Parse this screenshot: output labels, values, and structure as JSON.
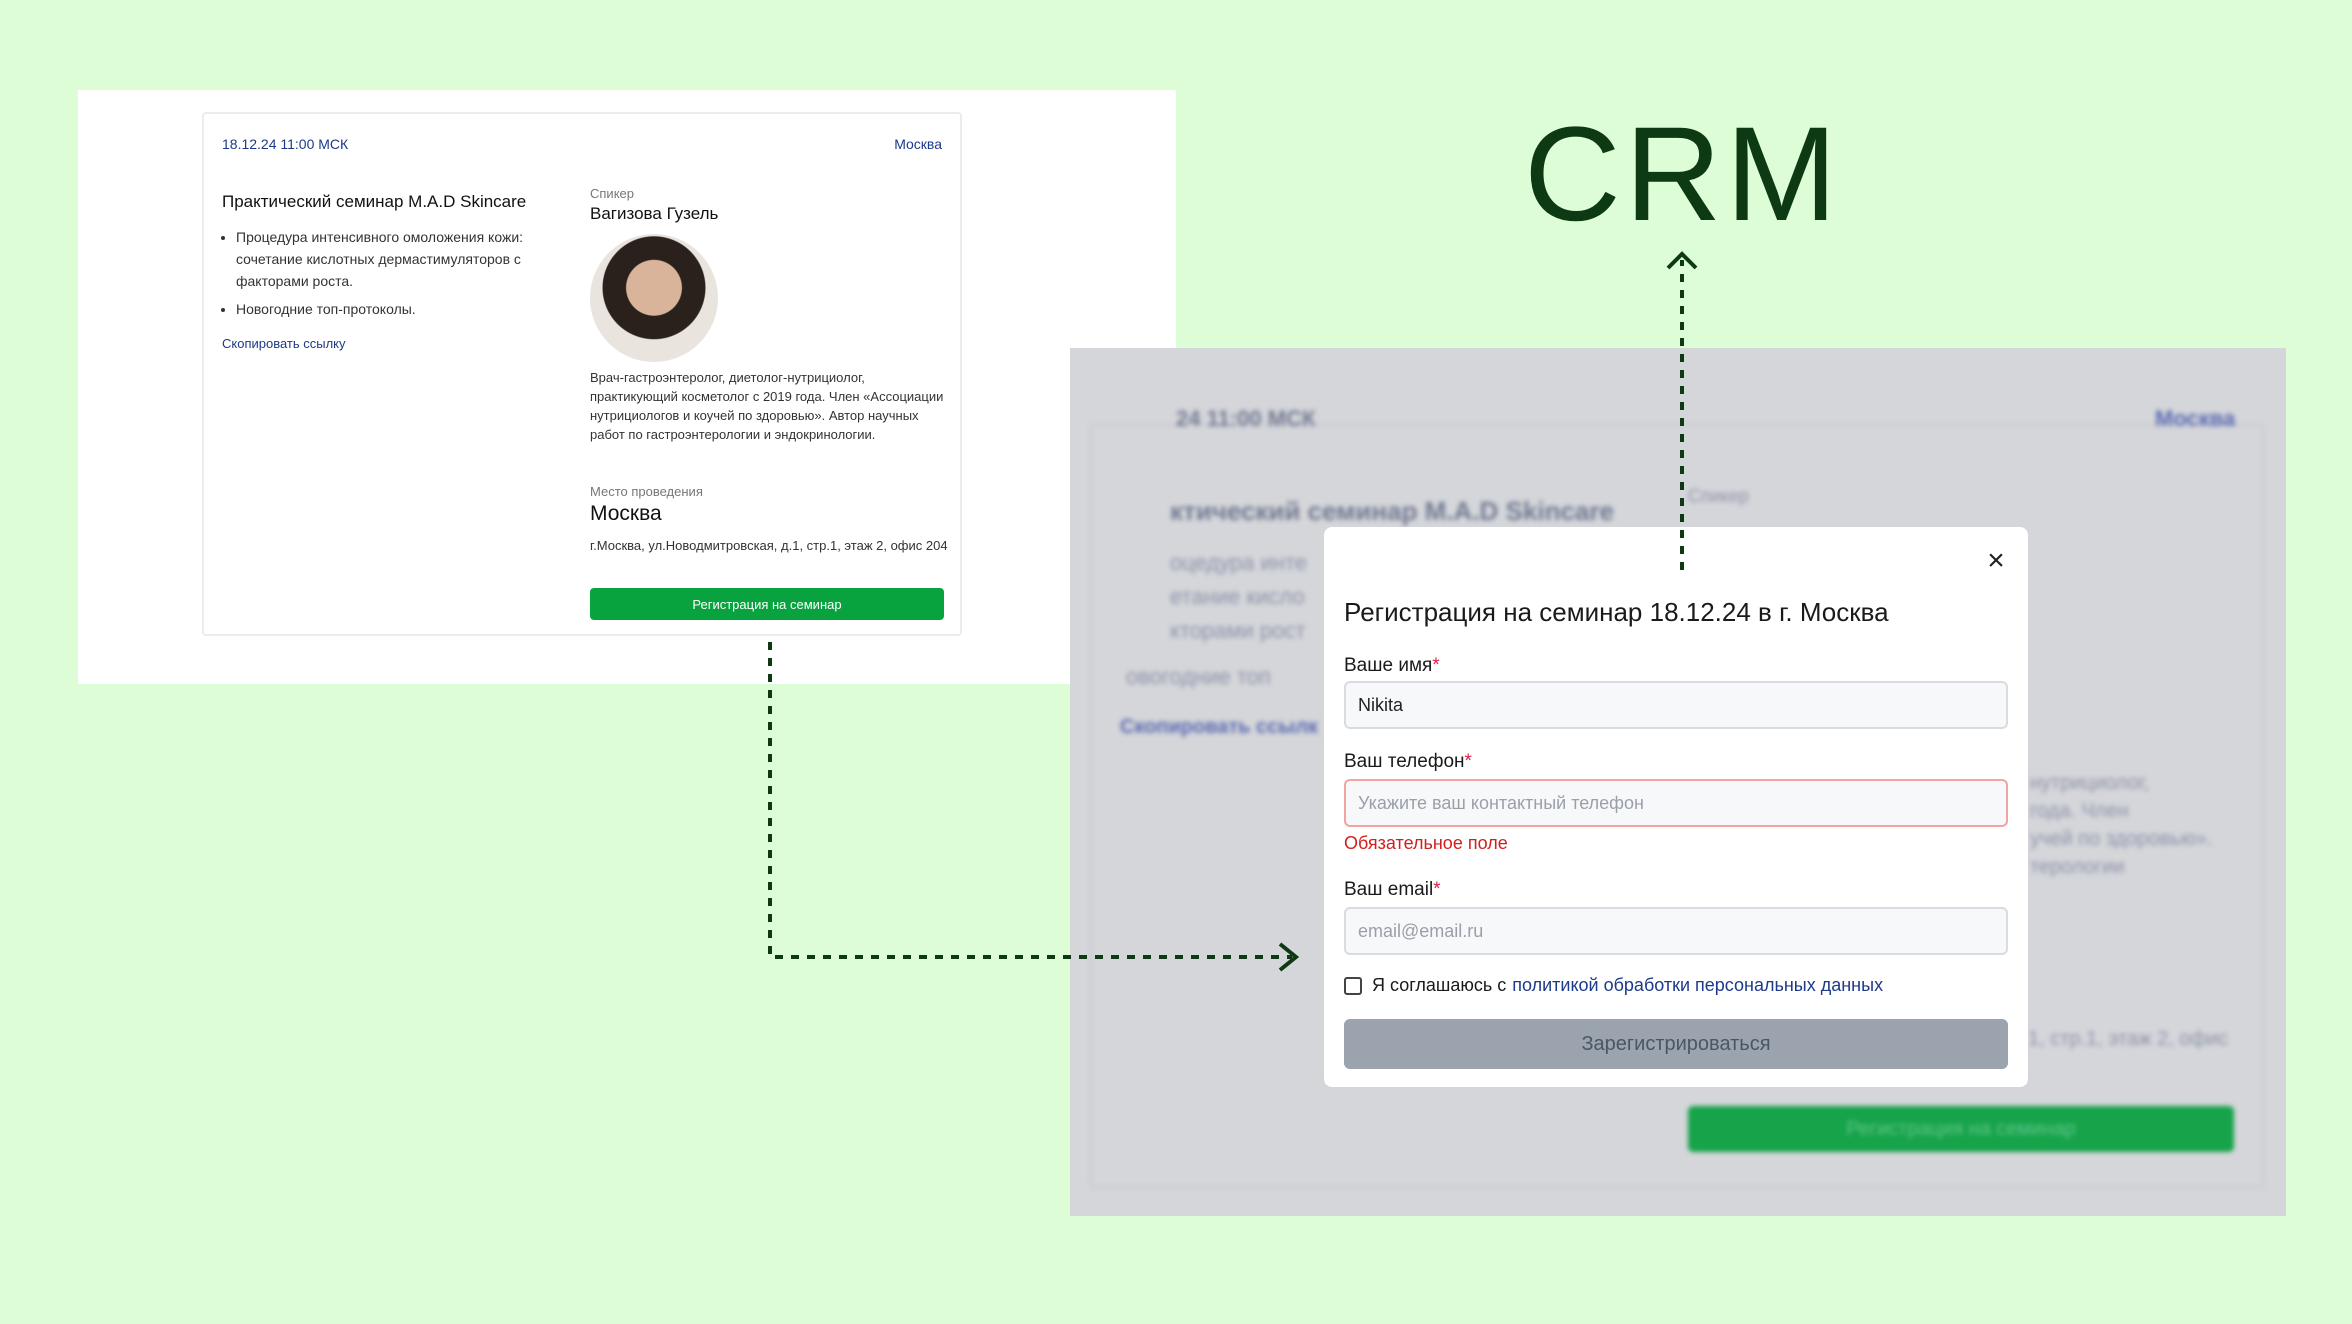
{
  "left_card": {
    "date": "18.12.24  11:00 МСК",
    "city_link": "Москва",
    "title": "Практический семинар M.A.D Skincare",
    "bullets": [
      "Процедура интенсивного омоложения кожи: сочетание кислотных дермастимуляторов с факторами роста.",
      "Новогодние топ-протоколы."
    ],
    "copy_link": "Скопировать ссылку",
    "speaker_caption": "Спикер",
    "speaker_name": "Вагизова Гузель",
    "bio": "Врач-гастроэнтеролог, диетолог-нутрициолог, практикующий косметолог с 2019 года. Член «Ассоциации нутрициологов и коучей по здоровью». Автор научных работ по гастроэнтерологии и эндокринологии.",
    "venue_caption": "Место проведения",
    "venue_name": "Москва",
    "address": "г.Москва, ул.Новодмитровская, д.1, стр.1, этаж 2, офис 204",
    "register_button": "Регистрация на семинар"
  },
  "crm_label": "CRM",
  "blurred_background": {
    "date": "24  11:00 МСК",
    "city": "Москва",
    "title": "ктический семинар M.A.D Skincare",
    "speaker_caption": "Спикер",
    "lines": [
      "оцедура инте",
      "етание кисло",
      "кторами рост",
      "овогодние топ"
    ],
    "copy_link": "Скопировать ссылк",
    "bio_lines": [
      "нутрициолог,",
      "года. Член",
      "учей по здоровью».",
      "терологии"
    ],
    "address_tail": "1, стр.1, этаж 2, офис",
    "register_button": "Регистрация на семинар"
  },
  "modal": {
    "close_icon": "close-icon",
    "title": "Регистрация на семинар 18.12.24 в г. Москва",
    "name_label": "Ваше имя",
    "name_value": "Nikita",
    "phone_label": "Ваш телефон",
    "phone_placeholder": "Укажите ваш контактный телефон",
    "phone_error": "Обязательное поле",
    "email_label": "Ваш email",
    "email_placeholder": "email@email.ru",
    "required_mark": "*",
    "agree_text": "Я соглашаюсь с",
    "agree_link": "политикой обработки персональных данных",
    "submit_button": "Зарегистрироваться"
  },
  "colors": {
    "page_background": "#dcfdd6",
    "accent_green": "#08a33f",
    "link_blue": "#1d3a8a",
    "error_red": "#d11f1f",
    "crm_text": "#0d3a12",
    "arrow": "#0d3a12"
  }
}
